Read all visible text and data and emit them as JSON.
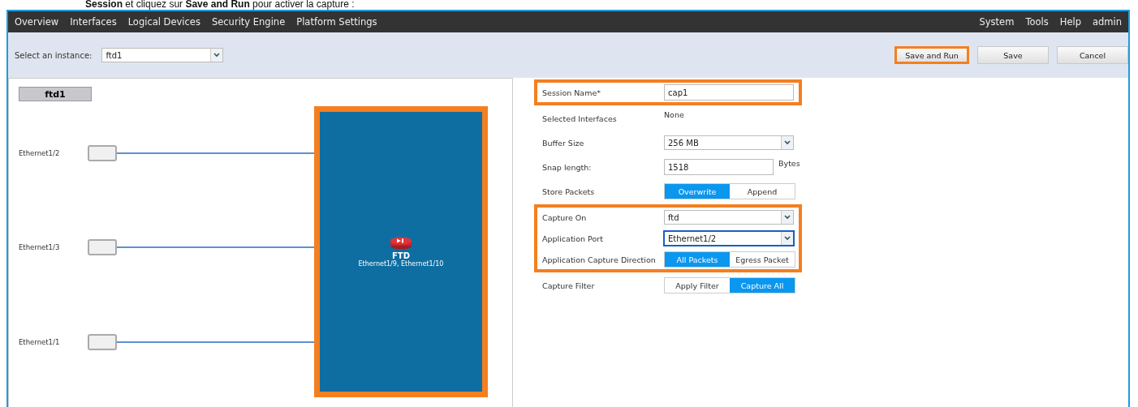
{
  "caption": "**Session** et cliquez sur **Save and Run** pour activer la capture :",
  "nav": {
    "left": [
      "Overview",
      "Interfaces",
      "Logical Devices",
      "Security Engine",
      "Platform Settings"
    ],
    "right": [
      "System",
      "Tools",
      "Help",
      "admin"
    ]
  },
  "toolbar": {
    "instance_label": "Select an instance:",
    "instance_value": "ftd1",
    "buttons": [
      {
        "label": "Save and Run",
        "highlighted": true
      },
      {
        "label": "Save",
        "highlighted": false
      },
      {
        "label": "Cancel",
        "highlighted": false
      }
    ]
  },
  "diagram": {
    "instance_tab": "ftd1",
    "ports": [
      {
        "name": "Ethernet1/2"
      },
      {
        "name": "Ethernet1/3"
      },
      {
        "name": "Ethernet1/1"
      }
    ],
    "app": {
      "name": "FTD",
      "interfaces": "Ethernet1/9, Ethernet1/10",
      "highlighted": true
    }
  },
  "form": {
    "sections": [
      {
        "highlighted": true,
        "rows": [
          {
            "kind": "text",
            "label": "Session Name*",
            "value": "cap1"
          }
        ]
      },
      {
        "highlighted": false,
        "rows": [
          {
            "kind": "static",
            "label": "Selected Interfaces",
            "value": "None"
          },
          {
            "kind": "select",
            "label": "Buffer Size",
            "value": "256 MB",
            "focused": false
          },
          {
            "kind": "text",
            "label": "Snap length:",
            "value": "1518",
            "unit": "Bytes"
          },
          {
            "kind": "toggle",
            "label": "Store Packets",
            "options": [
              {
                "label": "Overwrite",
                "selected": true
              },
              {
                "label": "Append",
                "selected": false
              }
            ]
          }
        ]
      },
      {
        "highlighted": true,
        "rows": [
          {
            "kind": "select",
            "label": "Capture On",
            "value": "ftd",
            "focused": false
          },
          {
            "kind": "select",
            "label": "Application Port",
            "value": "Ethernet1/2",
            "focused": true
          },
          {
            "kind": "toggle",
            "label": "Application Capture Direction",
            "options": [
              {
                "label": "All Packets",
                "selected": true
              },
              {
                "label": "Egress Packet",
                "selected": false
              }
            ]
          }
        ]
      },
      {
        "highlighted": false,
        "rows": [
          {
            "kind": "toggle",
            "label": "Capture Filter",
            "options": [
              {
                "label": "Apply Filter",
                "selected": false
              },
              {
                "label": "Capture All",
                "selected": true
              }
            ]
          }
        ]
      }
    ]
  }
}
